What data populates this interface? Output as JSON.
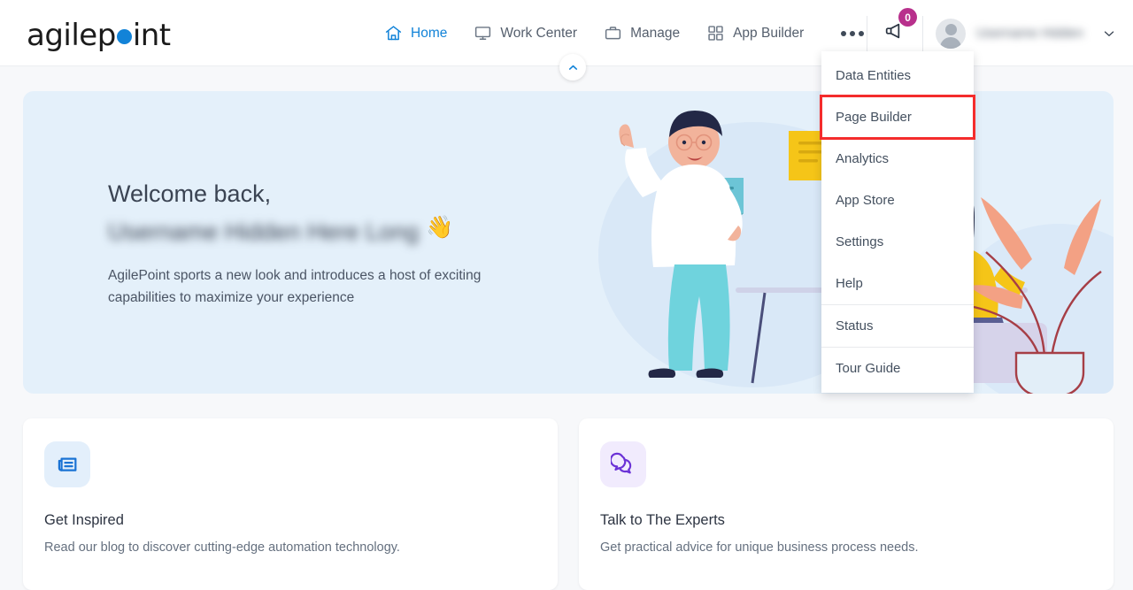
{
  "brand": {
    "text_a": "agilep",
    "text_b": "int",
    "dot": "blue-dot",
    "color": "#1283d8"
  },
  "header": {
    "nav": [
      {
        "label": "Home",
        "icon": "home-icon",
        "active": true
      },
      {
        "label": "Work Center",
        "icon": "monitor-icon",
        "active": false
      },
      {
        "label": "Manage",
        "icon": "briefcase-icon",
        "active": false
      },
      {
        "label": "App Builder",
        "icon": "grid-icon",
        "active": false
      }
    ],
    "more_button": "more-dots-icon",
    "announcement": {
      "icon": "megaphone-icon",
      "badge_count": "0",
      "badge_color": "#b8308c"
    },
    "user": {
      "name": "",
      "avatar": "user-avatar",
      "chevron": "chevron-down-icon"
    }
  },
  "collapse_button": {
    "icon": "chevron-up-icon"
  },
  "banner": {
    "greeting": "Welcome back,",
    "user_name": "",
    "wave_emoji": "👋",
    "description": "AgilePoint sports a new look and introduces a host of exciting capabilities to maximize your experience",
    "bg_color": "#e4f0fa"
  },
  "cards": [
    {
      "icon": "newspaper-icon",
      "icon_color": "#1a73d4",
      "title": "Get Inspired",
      "description": "Read our blog to discover cutting-edge automation technology."
    },
    {
      "icon": "chat-bubbles-icon",
      "icon_color": "#6b32d6",
      "title": "Talk to The Experts",
      "description": "Get practical advice for unique business process needs."
    }
  ],
  "dropdown": {
    "items": [
      {
        "label": "Data Entities",
        "highlighted": false,
        "separator_before": false
      },
      {
        "label": "Page Builder",
        "highlighted": true,
        "separator_before": false
      },
      {
        "label": "Analytics",
        "highlighted": false,
        "separator_before": false
      },
      {
        "label": "App Store",
        "highlighted": false,
        "separator_before": false
      },
      {
        "label": "Settings",
        "highlighted": false,
        "separator_before": false
      },
      {
        "label": "Help",
        "highlighted": false,
        "separator_before": false
      },
      {
        "label": "Status",
        "highlighted": false,
        "separator_before": true
      },
      {
        "label": "Tour Guide",
        "highlighted": false,
        "separator_before": true
      }
    ],
    "highlight_color": "#f42c2c"
  }
}
